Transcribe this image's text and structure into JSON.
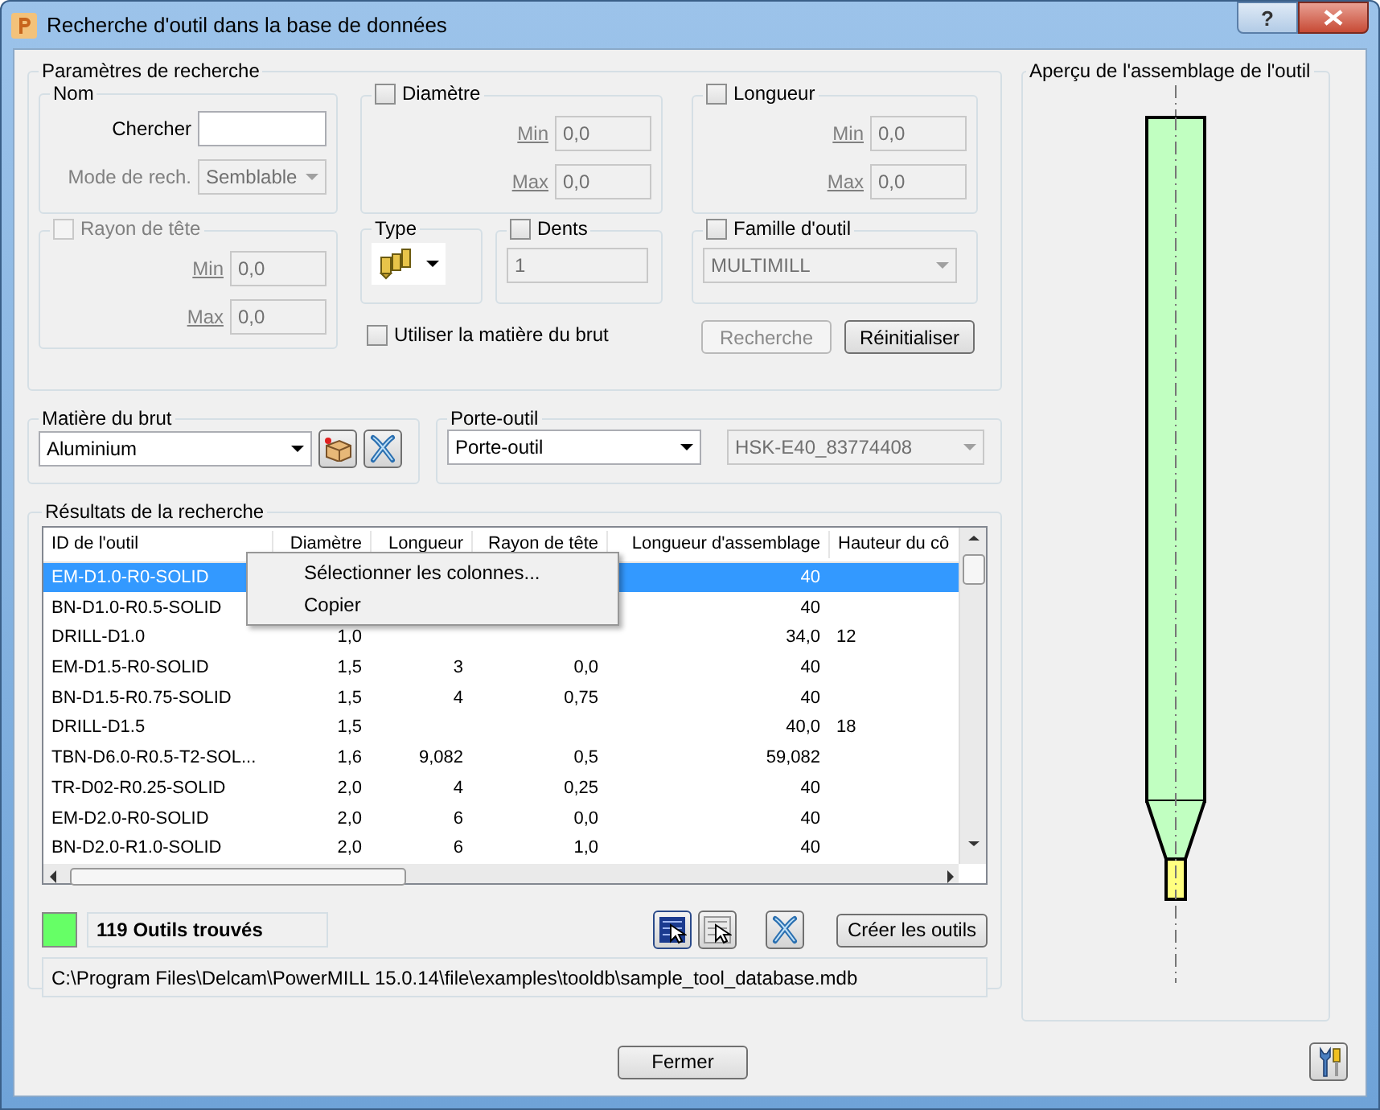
{
  "window": {
    "title": "Recherche d'outil dans la base de données",
    "help_button": "?"
  },
  "search_params": {
    "title": "Paramètres de recherche",
    "name_group": {
      "title": "Nom",
      "search_label": "Chercher",
      "mode_label": "Mode de rech.",
      "mode_value": "Semblable",
      "mode_disabled": true
    },
    "diameter": {
      "label": "Diamètre",
      "checked": false,
      "min_label": "Min",
      "min_value": "0,0",
      "max_label": "Max",
      "max_value": "0,0"
    },
    "length": {
      "label": "Longueur",
      "checked": false,
      "min_label": "Min",
      "min_value": "0,0",
      "max_label": "Max",
      "max_value": "0,0"
    },
    "tip_radius": {
      "label": "Rayon de tête",
      "checked": false,
      "disabled": true,
      "min_label": "Min",
      "min_value": "0,0",
      "max_label": "Max",
      "max_value": "0,0"
    },
    "type": {
      "label": "Type"
    },
    "teeth": {
      "label": "Dents",
      "checked": false,
      "value": "1"
    },
    "family": {
      "label": "Famille d'outil",
      "checked": false,
      "value": "MULTIMILL"
    },
    "use_stock": {
      "label": "Utiliser la matière du brut",
      "checked": false
    },
    "buttons": [
      {
        "label": "Recherche",
        "disabled": true
      },
      {
        "label": "Réinitialiser",
        "disabled": false
      }
    ]
  },
  "stock": {
    "title": "Matière du brut",
    "value": "Aluminium"
  },
  "holder": {
    "title": "Porte-outil",
    "value": "Porte-outil",
    "holder_value": "HSK-E40_83774408",
    "holder_disabled": true
  },
  "results": {
    "title": "Résultats de la recherche",
    "columns": [
      "ID de l'outil",
      "Diamètre",
      "Longueur",
      "Rayon de tête",
      "Longueur d'assemblage",
      "Hauteur du cô"
    ],
    "rows": [
      {
        "cells": [
          "EM-D1.0-R0-SOLID",
          "",
          "",
          "",
          "40",
          ""
        ],
        "selected": true
      },
      {
        "cells": [
          "BN-D1.0-R0.5-SOLID",
          "",
          "",
          "",
          "40",
          ""
        ],
        "selected": false
      },
      {
        "cells": [
          "DRILL-D1.0",
          "1,0",
          "",
          "",
          "34,0",
          "12"
        ],
        "selected": false
      },
      {
        "cells": [
          "EM-D1.5-R0-SOLID",
          "1,5",
          "3",
          "0,0",
          "40",
          ""
        ],
        "selected": false
      },
      {
        "cells": [
          "BN-D1.5-R0.75-SOLID",
          "1,5",
          "4",
          "0,75",
          "40",
          ""
        ],
        "selected": false
      },
      {
        "cells": [
          "DRILL-D1.5",
          "1,5",
          "",
          "",
          "40,0",
          "18"
        ],
        "selected": false
      },
      {
        "cells": [
          "TBN-D6.0-R0.5-T2-SOL...",
          "1,6",
          "9,082",
          "0,5",
          "59,082",
          ""
        ],
        "selected": false
      },
      {
        "cells": [
          "TR-D02-R0.25-SOLID",
          "2,0",
          "4",
          "0,25",
          "40",
          ""
        ],
        "selected": false
      },
      {
        "cells": [
          "EM-D2.0-R0-SOLID",
          "2,0",
          "6",
          "0,0",
          "40",
          ""
        ],
        "selected": false
      },
      {
        "cells": [
          "BN-D2.0-R1.0-SOLID",
          "2,0",
          "6",
          "1,0",
          "40",
          ""
        ],
        "selected": false
      }
    ],
    "context_menu": [
      "Sélectionner les colonnes...",
      "Copier"
    ],
    "count_text": "119 Outils trouvés",
    "create_button": "Créer les outils",
    "path": "C:\\Program Files\\Delcam\\PowerMILL 15.0.14\\file\\examples\\tooldb\\sample_tool_database.mdb"
  },
  "preview": {
    "title": "Aperçu de l'assemblage de l'outil"
  },
  "footer": {
    "close_button": "Fermer"
  }
}
